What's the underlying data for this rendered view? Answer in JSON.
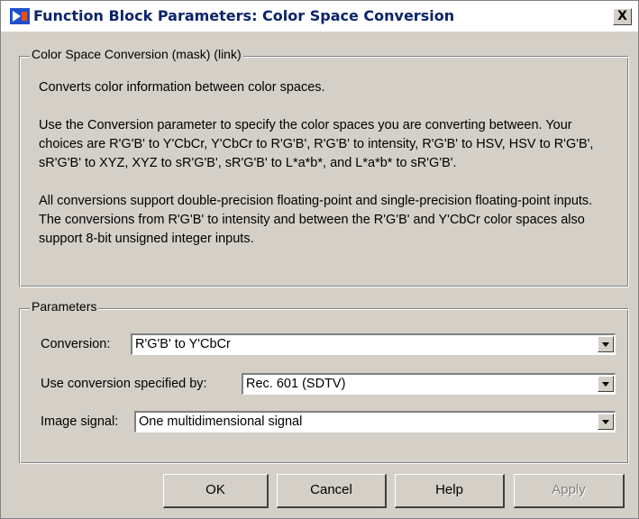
{
  "window": {
    "title": "Function Block Parameters: Color Space  Conversion",
    "close_label": "X"
  },
  "description_group": {
    "legend": "Color Space Conversion (mask) (link)",
    "paragraphs": [
      "Converts color information between color spaces.",
      "Use the Conversion parameter to specify the color spaces you are converting between. Your choices are R'G'B' to Y'CbCr, Y'CbCr to R'G'B', R'G'B' to intensity, R'G'B' to HSV, HSV to R'G'B', sR'G'B' to XYZ, XYZ to sR'G'B', sR'G'B' to L*a*b*, and L*a*b* to sR'G'B'.",
      "All conversions support double-precision floating-point and single-precision floating-point inputs. The conversions from R'G'B' to intensity and between the R'G'B' and Y'CbCr color spaces also support 8-bit unsigned integer inputs."
    ]
  },
  "parameters_group": {
    "legend": "Parameters",
    "fields": [
      {
        "label": "Conversion:",
        "value": "R'G'B' to Y'CbCr"
      },
      {
        "label": "Use conversion specified by:",
        "value": "Rec. 601 (SDTV)"
      },
      {
        "label": "Image signal:",
        "value": "One multidimensional signal"
      }
    ]
  },
  "buttons": {
    "ok": "OK",
    "cancel": "Cancel",
    "help": "Help",
    "apply": "Apply"
  },
  "colors": {
    "face": "#d4d0c8",
    "title_text": "#0a246a",
    "disabled_text": "#808080"
  },
  "icons": {
    "title": "simulink-block-icon",
    "close": "close-icon",
    "dropdown": "chevron-down-icon"
  }
}
